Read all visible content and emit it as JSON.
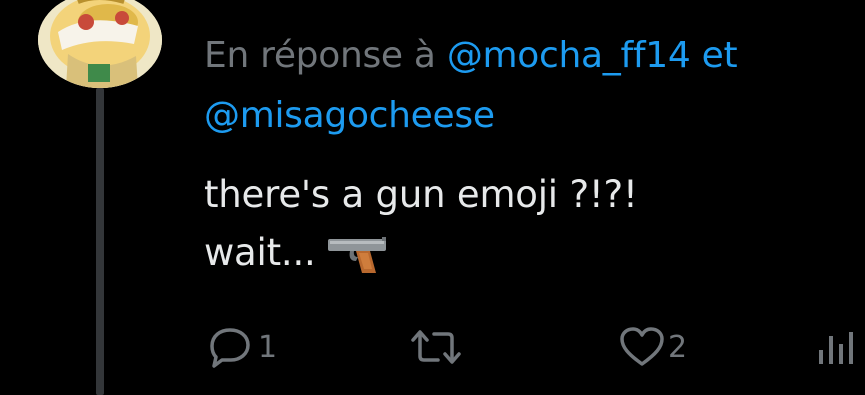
{
  "reply": {
    "prefix": "En réponse à",
    "mention_1": "@mocha_ff14",
    "conjunction": "et",
    "mention_2": "@misagocheese"
  },
  "tweet": {
    "line_1": "there's a gun emoji ?!?!",
    "line_2": "wait..."
  },
  "actions": {
    "reply_count": "1",
    "retweet_count": "",
    "like_count": "2"
  },
  "icons": {
    "reply": "reply-bubble-icon",
    "retweet": "retweet-icon",
    "like": "heart-icon",
    "views": "analytics-icon",
    "gun": "water-pistol-emoji"
  },
  "colors": {
    "background": "#000000",
    "text": "#e7e9ea",
    "muted": "#71767b",
    "link": "#1d9bf0",
    "thread_line": "#333639"
  }
}
